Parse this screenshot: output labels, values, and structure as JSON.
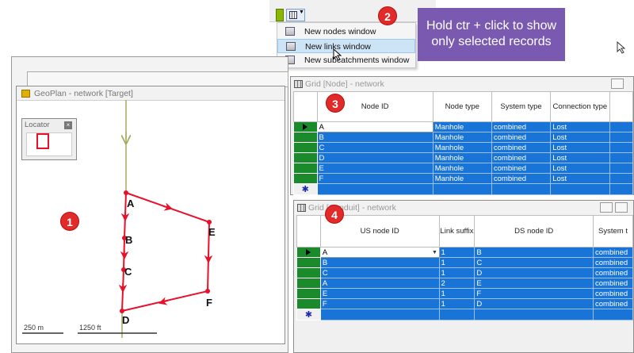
{
  "menu": {
    "items": [
      {
        "label": "New nodes window",
        "highlighted": false
      },
      {
        "label": "New links window",
        "highlighted": true
      },
      {
        "label": "New subcatchments window",
        "highlighted": false
      }
    ]
  },
  "badges": [
    "1",
    "2",
    "3",
    "4"
  ],
  "tooltip": {
    "line1": "Hold ctr + click to show",
    "line2": "only selected records"
  },
  "geoplan": {
    "title": "GeoPlan - network [Target]",
    "locator_title": "Locator",
    "locator_close": "×",
    "scale_m": "250 m",
    "scale_ft": "1250 ft",
    "node_labels": [
      "A",
      "B",
      "C",
      "D",
      "E",
      "F"
    ],
    "link_color": "#e8102a"
  },
  "node_grid": {
    "title": "Grid [Node] - network",
    "columns": [
      "Node ID",
      "Node type",
      "System type",
      "Connection type"
    ],
    "rows": [
      [
        "A",
        "Manhole",
        "combined",
        "Lost"
      ],
      [
        "B",
        "Manhole",
        "combined",
        "Lost"
      ],
      [
        "C",
        "Manhole",
        "combined",
        "Lost"
      ],
      [
        "D",
        "Manhole",
        "combined",
        "Lost"
      ],
      [
        "E",
        "Manhole",
        "combined",
        "Lost"
      ],
      [
        "F",
        "Manhole",
        "combined",
        "Lost"
      ]
    ],
    "new_row_marker": "✱"
  },
  "conduit_grid": {
    "title": "Grid [Conduit] - network",
    "columns": [
      "US node ID",
      "Link suffix",
      "DS node ID",
      "System t"
    ],
    "rows": [
      [
        "A",
        "1",
        "B",
        "combined"
      ],
      [
        "B",
        "1",
        "C",
        "combined"
      ],
      [
        "C",
        "1",
        "D",
        "combined"
      ],
      [
        "A",
        "2",
        "E",
        "combined"
      ],
      [
        "E",
        "1",
        "F",
        "combined"
      ],
      [
        "F",
        "1",
        "D",
        "combined"
      ]
    ],
    "new_row_marker": "✱"
  },
  "colors": {
    "selection": "#1874d6",
    "row_header": "#1a8a2a",
    "badge": "#e12a2a",
    "tooltip": "#7a5ab0"
  }
}
